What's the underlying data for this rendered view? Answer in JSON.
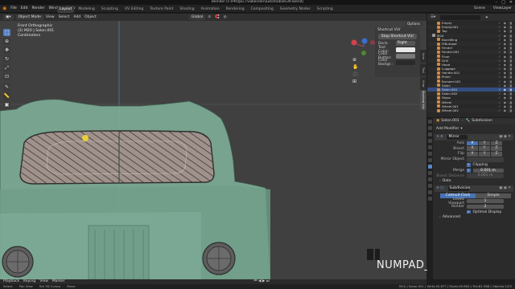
{
  "window": {
    "title": "Blender [F:\\PROJECTS\\Blender\\automobile\\39.blend]",
    "controls": [
      "–",
      "□",
      "✕"
    ]
  },
  "topbar": {
    "menus": [
      "File",
      "Edit",
      "Render",
      "Window",
      "Help"
    ],
    "workspaces": [
      "Layout",
      "Modeling",
      "Sculpting",
      "UV Editing",
      "Texture Paint",
      "Shading",
      "Animation",
      "Rendering",
      "Compositing",
      "Geometry Nodes",
      "Scripting"
    ],
    "active_workspace": "Layout",
    "scene": "Scene",
    "view_layer": "ViewLayer"
  },
  "viewport_header": {
    "mode": "Object Mode",
    "menus": [
      "View",
      "Select",
      "Add",
      "Object"
    ],
    "orientation": "Global"
  },
  "viewport": {
    "view_name": "Front Orthographic",
    "collection_path": "(2) M20 | Salon.001",
    "units": "Centimeters",
    "options_label": "Options",
    "overlay_text": "NUMPAD_1"
  },
  "screencast_panel": {
    "title": "Shortcut VUr",
    "stop_button": "Stop Shortcut VUr",
    "dock_label": "Dock:",
    "dock_value": "Right",
    "rows": [
      {
        "label": "Text Color:",
        "color": "#e8e8e8"
      },
      {
        "label": "Color Button:",
        "color": "#7a7a7a"
      },
      {
        "label": "Color Backgr.:",
        "color": "#2a2a2a"
      }
    ]
  },
  "side_tabs": [
    "Item",
    "Tool",
    "View",
    "Shortcut VUr"
  ],
  "timeline": {
    "items": [
      "Playback",
      "Keying",
      "View",
      "Marker"
    ]
  },
  "statusbar": {
    "left": [
      "Select",
      "Pan View",
      "Set 3D Cursor",
      "Move"
    ],
    "right": "M20 | Salon.001 | Verts:40.877 | Faces:40.804 | Tris:81.368 | Objects:1/53"
  },
  "outliner": {
    "rows": [
      {
        "label": "Empty",
        "color": "#d28c41"
      },
      {
        "label": "Empty.001",
        "color": "#d28c41"
      },
      {
        "label": "Top",
        "color": "#d28c41"
      },
      {
        "label": "M20",
        "color": "#9a9a9a"
      },
      {
        "label": "BackWing",
        "color": "#d28c41"
      },
      {
        "label": "FrBumper",
        "color": "#d28c41"
      },
      {
        "label": "Fender",
        "color": "#d28c41"
      },
      {
        "label": "Fender.001",
        "color": "#d28c41"
      },
      {
        "label": "Floor",
        "color": "#d28c41"
      },
      {
        "label": "Grill",
        "color": "#d28c41"
      },
      {
        "label": "Hood",
        "color": "#d28c41"
      },
      {
        "label": "Luggage",
        "color": "#d28c41"
      },
      {
        "label": "Handle.001",
        "color": "#d28c41"
      },
      {
        "label": "Prism",
        "color": "#d28c41"
      },
      {
        "label": "Bumper.001",
        "color": "#d28c41"
      },
      {
        "label": "Salon",
        "color": "#d28c41"
      },
      {
        "label": "Salon.001",
        "color": "#d28c41"
      },
      {
        "label": "Salon.002",
        "color": "#d28c41"
      },
      {
        "label": "Stops",
        "color": "#d28c41"
      },
      {
        "label": "Wheel",
        "color": "#d28c41"
      },
      {
        "label": "Wheel.001",
        "color": "#d28c41"
      },
      {
        "label": "Wheel.002",
        "color": "#d28c41"
      }
    ],
    "selected": "Salon.001"
  },
  "properties": {
    "object_name": "Salon.001",
    "modifier_context": "Subdivision",
    "add_modifier": "Add Modifier",
    "mirror": {
      "name": "Mirror",
      "axis_label": "Axis",
      "bisect_label": "Bisect",
      "flip_label": "Flip",
      "axes": [
        "X",
        "Y",
        "Z"
      ],
      "mirror_object_label": "Mirror Object",
      "clipping_label": "Clipping",
      "merge_label": "Merge",
      "merge_value": "0.001 m",
      "bisect_distance_label": "Bisect Distance",
      "bisect_distance_value": "0.001 m",
      "data_label": "Data"
    },
    "subdivision": {
      "name": "Subdivision",
      "catmull_label": "Catmull-Clark",
      "simple_label": "Simple",
      "levels_label": "Levels Viewport",
      "levels_value": "1",
      "render_label": "Render",
      "render_value": "2",
      "optimal_label": "Optimal Display",
      "advanced_label": "Advanced"
    }
  },
  "colors": {
    "accent": "#4772b3",
    "car_body": "#7fb099",
    "window_tint": "#b08a8a"
  }
}
